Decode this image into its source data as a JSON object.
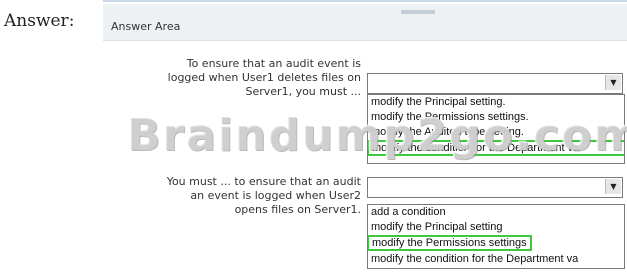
{
  "answer_label": "Answer:",
  "panel": {
    "title": "Answer Area"
  },
  "questions": [
    {
      "text_lines": [
        "To ensure that an audit event is",
        "logged when User1 deletes files on",
        "Server1, you must ..."
      ],
      "selected_value": "",
      "options": [
        "modify the Principal setting.",
        "modify the Permissions settings.",
        "modify the Audited type setting.",
        "modify the condition for the Department va"
      ],
      "highlighted_index": 3
    },
    {
      "text_lines": [
        "You must ... to ensure that an audit",
        "an event is logged when User2",
        "opens files on Server1."
      ],
      "selected_value": "",
      "options": [
        "add a condition",
        "modify the Principal setting",
        "modify the Permissions settings",
        "modify the condition for the Department va"
      ],
      "highlighted_index": 2
    }
  ],
  "watermark": "Braindump2go.com",
  "colors": {
    "highlight": "#3fc83f",
    "header_bg": "#eef1f4"
  },
  "icons": [
    "dropdown-arrow-icon"
  ]
}
